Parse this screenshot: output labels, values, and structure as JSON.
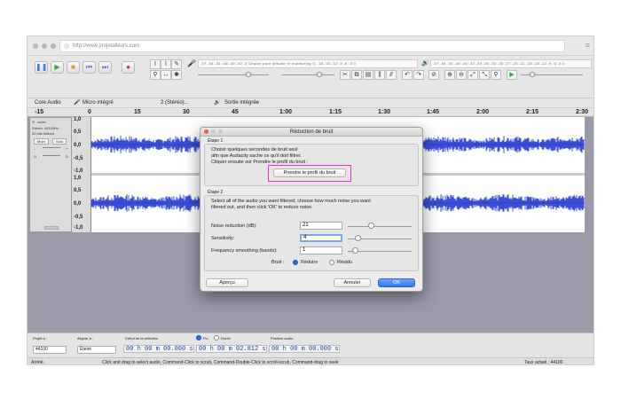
{
  "browser": {
    "url": "http://www.projetalleurs.com"
  },
  "toolbar": {
    "meter_record_ticks": "-57 -54 -51 -48 -45 -42 -3 Cliquer pour débuter le monitoring !1 -18 -15 -12 -9 -6 -3 0",
    "meter_play_ticks": "-57 -54 -51 -48 -45 -42 -39 -36 -33 -30 -27 -24 -21 -18 -15 -12 -9 -6 -3 0"
  },
  "device_bar": {
    "host": "Core Audio",
    "mic": "Micro intégré",
    "channels": "2 (Stéréo)...",
    "output": "Sortie intégrée"
  },
  "ruler": {
    "ticks": [
      "-15",
      "0",
      "15",
      "30",
      "45",
      "1:00",
      "1:15",
      "1:30",
      "1:45",
      "2:00",
      "2:15",
      "2:30"
    ]
  },
  "track": {
    "name": "cover",
    "info1": "Stéréo, 44100Hz",
    "info2": "32 bits flottant",
    "mute": "Muet",
    "solo": "Solo",
    "left": "G",
    "right": "D",
    "scale": [
      "1,0",
      "0,5",
      "0,0",
      "-0,5",
      "-1,0",
      "1,0",
      "0,5",
      "0,0",
      "-0,5",
      "-1,0"
    ]
  },
  "dialog": {
    "title": "Réduction de bruit",
    "step1_label": "Étape 1",
    "step1_text1": "Choisir quelques secondes de bruit seul",
    "step1_text2": "afin que Audacity sache ce qu'il doit filtrer.",
    "step1_text3": "Cliquer ensuite sur Prendre le profil du bruit :",
    "profile_button": "Prendre le profil du bruit",
    "step2_label": "Étape 2",
    "step2_text1": "Select all of the audio you want filtered, choose how much noise you want",
    "step2_text2": "filtered out, and then click 'OK' to reduce noise.",
    "noise_label": "Noise reduction (dB):",
    "noise_value": "21",
    "noise_level": 0.35,
    "sensitivity_label": "Sensitivity:",
    "sensitivity_value": "4",
    "sensitivity_level": 0.12,
    "smoothing_label": "Frequency smoothing (bands):",
    "smoothing_value": "1",
    "smoothing_level": 0.08,
    "bruit_label": "Bruit :",
    "reduce_label": "Réduire",
    "residue_label": "Résidu",
    "preview_button": "Aperçu",
    "cancel_button": "Annuler",
    "ok_button": "OK"
  },
  "bottom": {
    "project_rate_label": "Projet à :",
    "project_rate": "44100",
    "snap_label": "Aligner à :",
    "snap_value": "Éteint",
    "sel_start_label": "Début de la sélection",
    "end_label": "Fin",
    "length_label": "Durée",
    "pos_label": "Position audio :",
    "time1": "00 h 00 m 00.000 s",
    "time2": "00 h 00 m 02.812 s",
    "time3": "00 h 00 m 00.000 s"
  },
  "status": {
    "state": "Arrêté.",
    "hint": "Click and drag to select audio, Command-Click to scrub, Command-Double-Click to scroll-scrub, Command-drag to seek",
    "rate": "Taux actuel : 44100"
  },
  "colors": {
    "waveform": "#3b4fd6",
    "highlight": "#e52fd8",
    "ok": "#2d77f0"
  }
}
